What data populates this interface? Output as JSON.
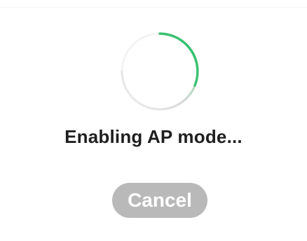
{
  "status": {
    "message": "Enabling AP mode..."
  },
  "spinner": {
    "icon": "loading-spinner-icon",
    "accent_color": "#2fbf6a",
    "track_fade_color": "#e8e8e8"
  },
  "actions": {
    "cancel_label": "Cancel",
    "cancel_color": "#b9b9b9"
  }
}
